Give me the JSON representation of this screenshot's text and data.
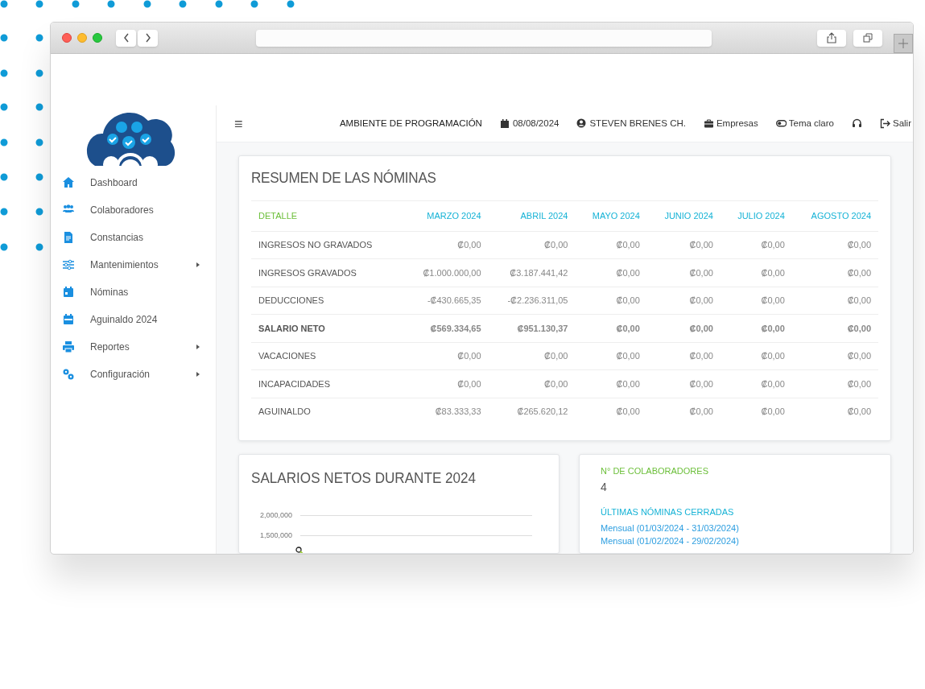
{
  "sidebar": {
    "items": [
      {
        "label": "Dashboard",
        "submenu": false
      },
      {
        "label": "Colaboradores",
        "submenu": false
      },
      {
        "label": "Constancias",
        "submenu": false
      },
      {
        "label": "Mantenimientos",
        "submenu": true
      },
      {
        "label": "Nóminas",
        "submenu": false
      },
      {
        "label": "Aguinaldo 2024",
        "submenu": false
      },
      {
        "label": "Reportes",
        "submenu": true
      },
      {
        "label": "Configuración",
        "submenu": true
      }
    ]
  },
  "header": {
    "menu_icon": "≡",
    "environment": "AMBIENTE DE PROGRAMACIÓN",
    "links": [
      "08/08/2024",
      "STEVEN BRENES CH.",
      "Empresas",
      "Tema claro",
      "Salir"
    ]
  },
  "summary": {
    "title": "RESUMEN DE LAS NÓMINAS",
    "columns": [
      {
        "label": "DETALLE",
        "color": "#6cbf3a"
      },
      {
        "label": "MARZO 2024",
        "color": "#17b3d6"
      },
      {
        "label": "ABRIL 2024",
        "color": "#17b3d6"
      },
      {
        "label": "MAYO 2024",
        "color": "#17b3d6"
      },
      {
        "label": "JUNIO 2024",
        "color": "#17b3d6"
      },
      {
        "label": "JULIO 2024",
        "color": "#17b3d6"
      },
      {
        "label": "AGOSTO 2024",
        "color": "#17b3d6"
      }
    ],
    "rows": [
      {
        "bold": false,
        "cells": [
          "INGRESOS NO GRAVADOS",
          "₡0,00",
          "₡0,00",
          "₡0,00",
          "₡0,00",
          "₡0,00",
          "₡0,00"
        ]
      },
      {
        "bold": false,
        "cells": [
          "INGRESOS GRAVADOS",
          "₡1.000.000,00",
          "₡3.187.441,42",
          "₡0,00",
          "₡0,00",
          "₡0,00",
          "₡0,00"
        ]
      },
      {
        "bold": false,
        "cells": [
          "DEDUCCIONES",
          "-₡430.665,35",
          "-₡2.236.311,05",
          "₡0,00",
          "₡0,00",
          "₡0,00",
          "₡0,00"
        ]
      },
      {
        "bold": true,
        "cells": [
          "SALARIO NETO",
          "₡569.334,65",
          "₡951.130,37",
          "₡0,00",
          "₡0,00",
          "₡0,00",
          "₡0,00"
        ]
      },
      {
        "bold": false,
        "cells": [
          "VACACIONES",
          "₡0,00",
          "₡0,00",
          "₡0,00",
          "₡0,00",
          "₡0,00",
          "₡0,00"
        ]
      },
      {
        "bold": false,
        "cells": [
          "INCAPACIDADES",
          "₡0,00",
          "₡0,00",
          "₡0,00",
          "₡0,00",
          "₡0,00",
          "₡0,00"
        ]
      },
      {
        "bold": false,
        "cells": [
          "AGUINALDO",
          "₡83.333,33",
          "₡265.620,12",
          "₡0,00",
          "₡0,00",
          "₡0,00",
          "₡0,00"
        ]
      }
    ]
  },
  "salary_chart": {
    "title": "SALARIOS NETOS DURANTE 2024",
    "y_tick_labels": [
      "2,000,000",
      "1,500,000"
    ]
  },
  "info": {
    "collaborators_label": "N° DE COLABORADORES",
    "collaborators_count": "4",
    "closed_label": "ÚLTIMAS NÓMINAS CERRADAS",
    "closed_payrolls": [
      "Mensual (01/03/2024 - 31/03/2024)",
      "Mensual (01/02/2024 - 29/02/2024)"
    ]
  }
}
